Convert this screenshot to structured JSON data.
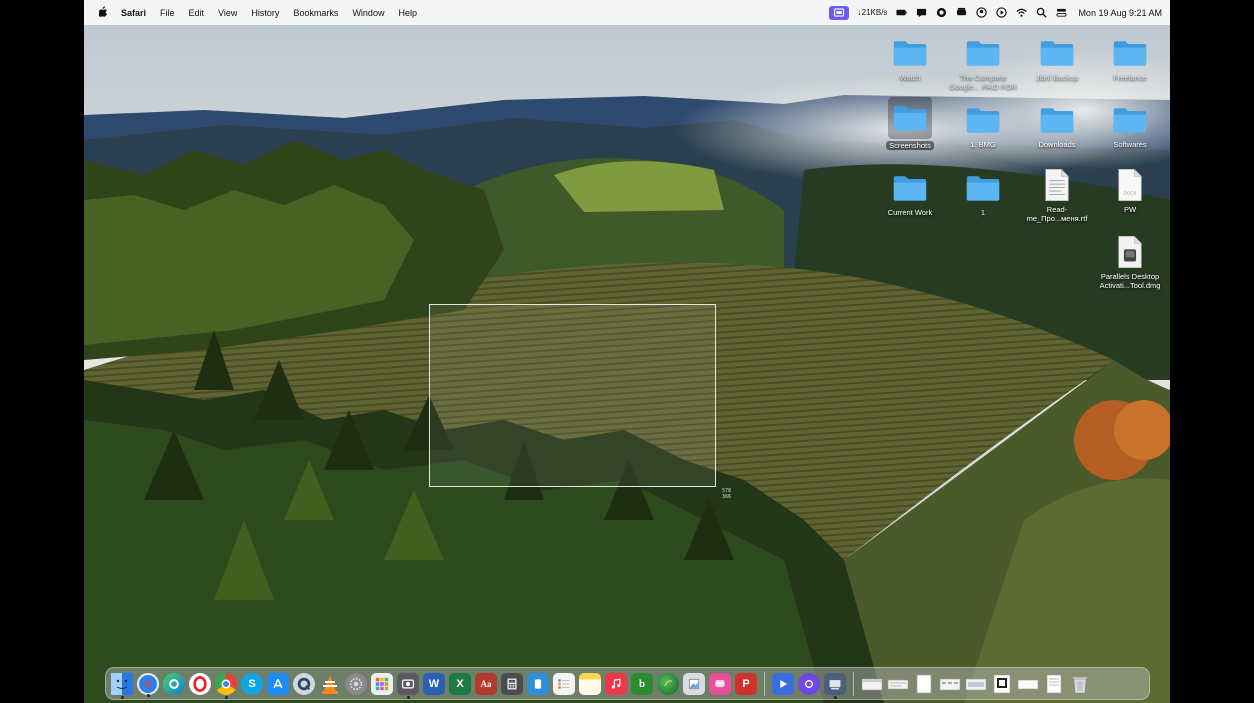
{
  "menubar": {
    "app_name": "Safari",
    "menus": [
      "File",
      "Edit",
      "View",
      "History",
      "Bookmarks",
      "Window",
      "Help"
    ],
    "network_speed": "↓21KB/s",
    "clock": "Mon 19 Aug  9:21 AM",
    "status_icons": [
      "screen-recorder-icon",
      "network-monitor-icon",
      "battery-icon",
      "notification-icon",
      "chat-icon",
      "game-controller-icon",
      "user-account-icon",
      "play-circle-icon",
      "wifi-icon",
      "spotlight-search-icon",
      "control-center-icon"
    ]
  },
  "desktop": {
    "items": [
      {
        "label": "Watch",
        "kind": "folder",
        "faded": true
      },
      {
        "label": "The Complete Google... PAID FOR",
        "kind": "folder",
        "faded": true
      },
      {
        "label": "Jibril Backup",
        "kind": "folder",
        "faded": true
      },
      {
        "label": "Freelance",
        "kind": "folder",
        "faded": true
      },
      {
        "label": "Screenshots",
        "kind": "folder",
        "selected": true
      },
      {
        "label": "1. BMG",
        "kind": "folder"
      },
      {
        "label": "Downloads",
        "kind": "folder"
      },
      {
        "label": "Softwares",
        "kind": "folder"
      },
      {
        "label": "Current Work",
        "kind": "folder"
      },
      {
        "label": "1",
        "kind": "folder"
      },
      {
        "label": "Read-me_Про...меня.rtf",
        "kind": "rtf-document"
      },
      {
        "label": "PW",
        "kind": "docx-document"
      },
      {
        "label": "Parallels Desktop Activati...Tool.dmg",
        "kind": "disk-image"
      }
    ]
  },
  "selection": {
    "dimension_readout": "578\n366"
  },
  "dock": {
    "apps": [
      {
        "name": "finder-icon",
        "color": "#3d8ff0"
      },
      {
        "name": "safari-icon",
        "color": "#2f7fe6"
      },
      {
        "name": "edge-icon",
        "color": "#1a9ad6"
      },
      {
        "name": "opera-icon",
        "color": "#e0242e"
      },
      {
        "name": "chrome-icon",
        "color": "#e9b234"
      },
      {
        "name": "skype-icon",
        "color": "#0ea4e8"
      },
      {
        "name": "app-store-icon",
        "color": "#1b8cf5"
      },
      {
        "name": "quicktime-icon",
        "color": "#2a4662"
      },
      {
        "name": "vlc-icon",
        "color": "#f28a1a"
      },
      {
        "name": "system-settings-icon",
        "color": "#8a8a90"
      },
      {
        "name": "launchpad-icon",
        "color": "#f2b83b"
      },
      {
        "name": "screenshot-icon",
        "color": "#5a5a60"
      },
      {
        "name": "word-icon",
        "color": "#2b5fb4"
      },
      {
        "name": "excel-icon",
        "color": "#1e7a43"
      },
      {
        "name": "dictionary-icon",
        "color": "#b33a2c"
      },
      {
        "name": "calculator-icon",
        "color": "#4b4b4f"
      },
      {
        "name": "teams-icon",
        "color": "#2d8fdc"
      },
      {
        "name": "reminders-icon",
        "color": "#f5f5f5"
      },
      {
        "name": "notes-icon",
        "color": "#f6d94a"
      },
      {
        "name": "music-icon",
        "color": "#f2364a"
      },
      {
        "name": "bbedit-icon",
        "color": "#2e8a2e"
      },
      {
        "name": "globe-app-icon",
        "color": "#2f7d3a"
      },
      {
        "name": "preview-icon",
        "color": "#d9dde3"
      },
      {
        "name": "pink-app-icon",
        "color": "#e94f9b"
      },
      {
        "name": "wps-icon",
        "color": "#d0312d"
      },
      {
        "name": "quick-player-icon",
        "color": "#3a6ee0"
      },
      {
        "name": "purple-app-icon",
        "color": "#7346e6"
      },
      {
        "name": "screen-recorder-dock-icon",
        "color": "#4b5f7a"
      }
    ],
    "recents": [
      "window-thumbnail-icon",
      "window-thumbnail-icon",
      "document-icon",
      "window-thumbnail-icon",
      "window-thumbnail-icon",
      "qr-document-icon",
      "window-thumbnail-icon",
      "document-icon"
    ],
    "trash": "trash-icon"
  },
  "colors": {
    "folder": "#5db6f1",
    "folder_dark": "#3f9ee0",
    "menubar_accent": "#6b5cf0"
  }
}
